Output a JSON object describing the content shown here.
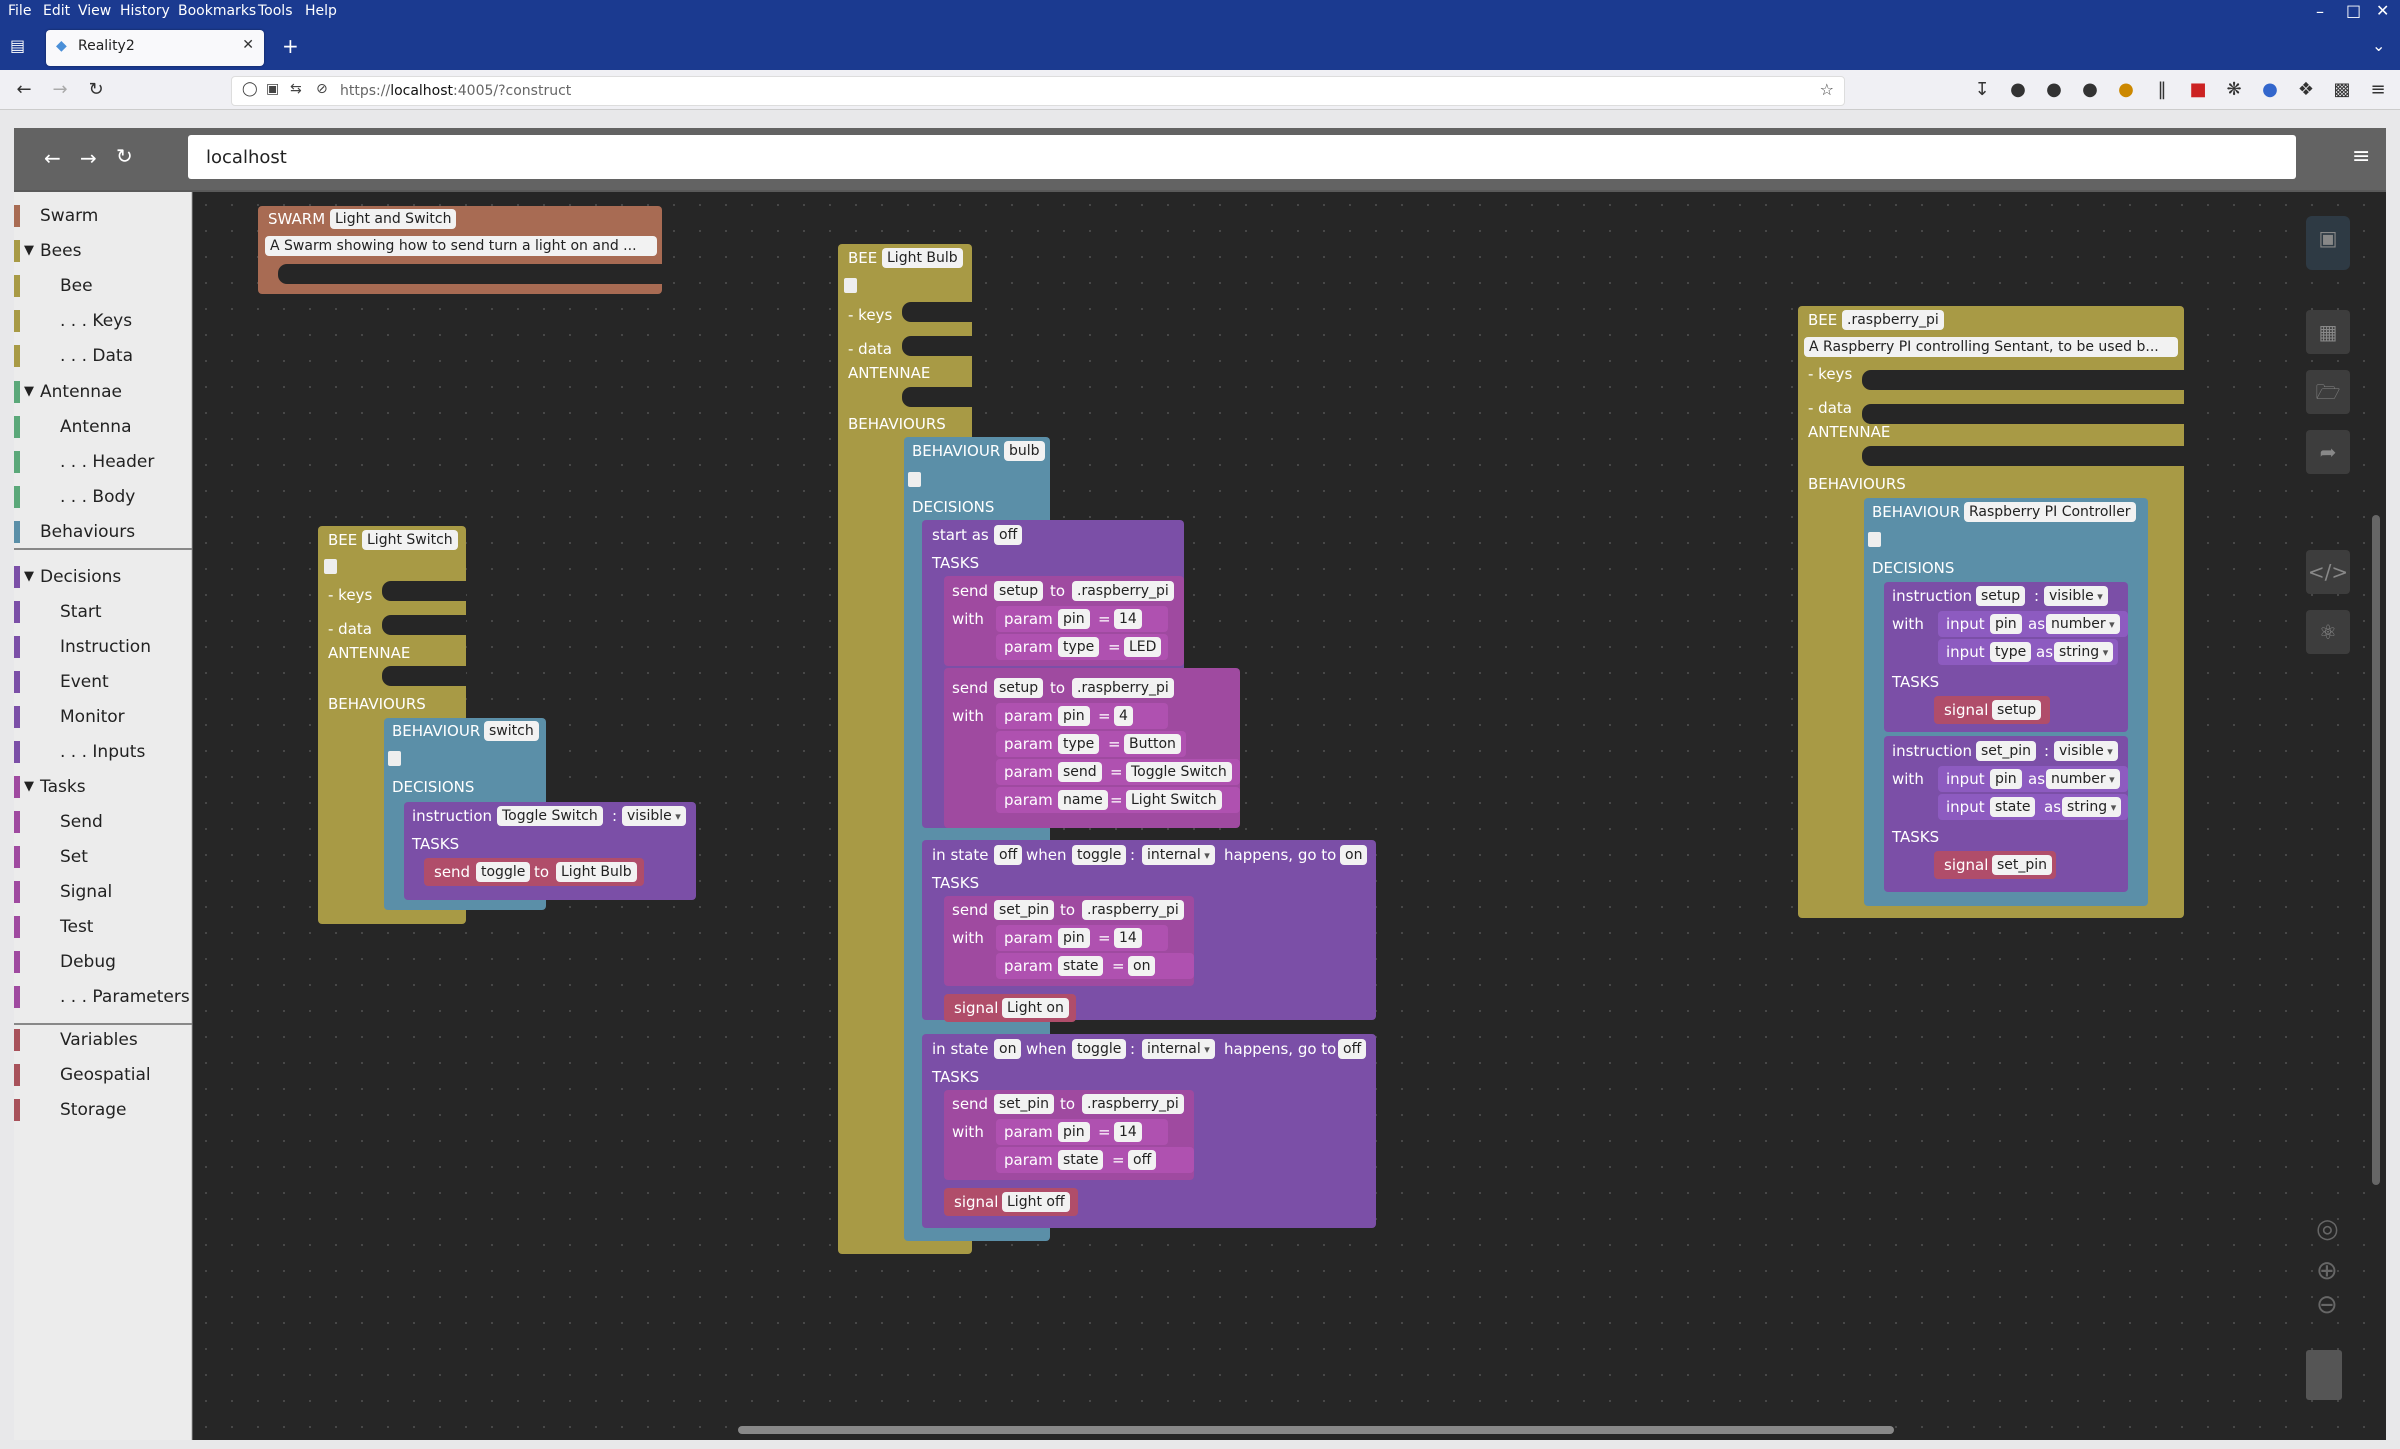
{
  "browser": {
    "menu": [
      "File",
      "Edit",
      "View",
      "History",
      "Bookmarks",
      "Tools",
      "Help"
    ],
    "tab_title": "Reality2",
    "url_prefix": "https://",
    "url_host": "localhost",
    "url_rest": ":4005/?construct"
  },
  "app": {
    "address": "localhost"
  },
  "sidebar": {
    "items": [
      {
        "label": "Swarm",
        "color": "#a86b53"
      },
      {
        "label": "Bees",
        "color": "#a89a45",
        "caret": true
      },
      {
        "label": "Bee",
        "color": "#a89a45"
      },
      {
        "label": ". . . Keys",
        "color": "#a89a45"
      },
      {
        "label": ". . . Data",
        "color": "#a89a45"
      },
      {
        "label": "Antennae",
        "color": "#5ba87a",
        "caret": true
      },
      {
        "label": "Antenna",
        "color": "#5ba87a"
      },
      {
        "label": ". . . Header",
        "color": "#5ba87a"
      },
      {
        "label": ". . . Body",
        "color": "#5ba87a"
      },
      {
        "label": "Behaviours",
        "color": "#5b8fa8"
      },
      {
        "label": "Decisions",
        "color": "#7b4fa7",
        "caret": true
      },
      {
        "label": "Start",
        "color": "#7b4fa7"
      },
      {
        "label": "Instruction",
        "color": "#7b4fa7"
      },
      {
        "label": "Event",
        "color": "#7b4fa7"
      },
      {
        "label": "Monitor",
        "color": "#7b4fa7"
      },
      {
        "label": ". . . Inputs",
        "color": "#7b4fa7"
      },
      {
        "label": "Tasks",
        "color": "#9f4aa0",
        "caret": true
      },
      {
        "label": "Send",
        "color": "#9f4aa0"
      },
      {
        "label": "Set",
        "color": "#9f4aa0"
      },
      {
        "label": "Signal",
        "color": "#9f4aa0"
      },
      {
        "label": "Test",
        "color": "#9f4aa0"
      },
      {
        "label": "Debug",
        "color": "#9f4aa0"
      },
      {
        "label": ". . . Parameters",
        "color": "#9f4aa0"
      },
      {
        "label": "Variables",
        "color": "#a8525b"
      },
      {
        "label": "Geospatial",
        "color": "#a8525b"
      },
      {
        "label": "Storage",
        "color": "#a8525b"
      }
    ]
  },
  "kw": {
    "swarm": "SWARM",
    "bee": "BEE",
    "keys": "- keys",
    "data": "- data",
    "antennae": "ANTENNAE",
    "behaviours": "BEHAVIOURS",
    "behaviour": "BEHAVIOUR",
    "decisions": "DECISIONS",
    "tasks": "TASKS",
    "instruction": "instruction",
    "send": "send",
    "to": "to",
    "with": "with",
    "param": "param",
    "eq": "=",
    "signal": "signal",
    "start_as": "start as",
    "in_state": "in state",
    "when": "when",
    "happens": "happens, go to",
    "input": "input",
    "as": "as",
    "colon": ":"
  },
  "swarm": {
    "name": "Light and Switch",
    "description": "A Swarm showing how to send turn a light on and ..."
  },
  "light_switch": {
    "name": "Light Switch",
    "behaviour": "switch",
    "instruction": "Toggle Switch",
    "visibility": "visible",
    "send_event": "toggle",
    "send_to": "Light Bulb"
  },
  "light_bulb": {
    "name": "Light Bulb",
    "behaviour": "bulb",
    "start": "off",
    "send1": {
      "event": "setup",
      "to": ".raspberry_pi",
      "params": [
        [
          "pin",
          "14"
        ],
        [
          "type",
          "LED"
        ]
      ]
    },
    "send2": {
      "event": "setup",
      "to": ".raspberry_pi",
      "params": [
        [
          "pin",
          "4"
        ],
        [
          "type",
          "Button"
        ],
        [
          "send",
          "Toggle Switch"
        ],
        [
          "name",
          "Light Switch"
        ]
      ]
    },
    "t1": {
      "from": "off",
      "event": "toggle",
      "scope": "internal",
      "to": "on",
      "send_event": "set_pin",
      "send_to": ".raspberry_pi",
      "params": [
        [
          "pin",
          "14"
        ],
        [
          "state",
          "on"
        ]
      ],
      "signal": "Light on"
    },
    "t2": {
      "from": "on",
      "event": "toggle",
      "scope": "internal",
      "to": "off",
      "send_event": "set_pin",
      "send_to": ".raspberry_pi",
      "params": [
        [
          "pin",
          "14"
        ],
        [
          "state",
          "off"
        ]
      ],
      "signal": "Light off"
    }
  },
  "raspberry_pi": {
    "name": ".raspberry_pi",
    "description": "A Raspberry PI controlling Sentant, to be used b...",
    "behaviour": "Raspberry PI Controller",
    "i1": {
      "name": "setup",
      "visibility": "visible",
      "inputs": [
        [
          "pin",
          "number"
        ],
        [
          "type",
          "string"
        ]
      ],
      "signal": "setup"
    },
    "i2": {
      "name": "set_pin",
      "visibility": "visible",
      "inputs": [
        [
          "pin",
          "number"
        ],
        [
          "state",
          "string"
        ]
      ],
      "signal": "set_pin"
    }
  }
}
